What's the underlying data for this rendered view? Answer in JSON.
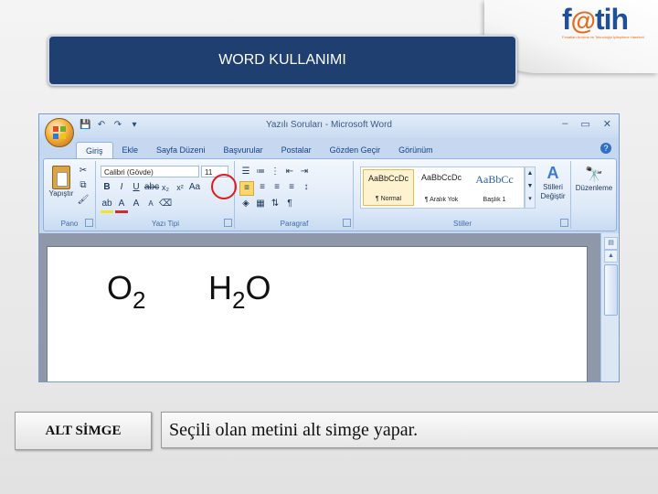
{
  "slide": {
    "title": "WORD KULLANIMI",
    "logo": {
      "name": "fatih-logo",
      "text_f": "f",
      "text_at": "@",
      "text_rest": "tih",
      "subtitle": "Fırsatları Artırma ve Teknolojiyi İyileştirme Hareketi"
    },
    "term": "ALT SİMGE",
    "definition": "Seçili olan metini alt simge yapar."
  },
  "word": {
    "window_title": "Yazılı Soruları - Microsoft Word",
    "quick_access": [
      "save-icon",
      "undo-icon",
      "redo-icon",
      "customize-icon"
    ],
    "window_controls": [
      "–",
      "▭",
      "✕"
    ],
    "tabs": [
      "Giriş",
      "Ekle",
      "Sayfa Düzeni",
      "Başvurular",
      "Postalar",
      "Gözden Geçir",
      "Görünüm"
    ],
    "active_tab": "Giriş",
    "groups": {
      "clipboard": {
        "label": "Pano",
        "paste_label": "Yapıştır"
      },
      "font": {
        "label": "Yazı Tipi",
        "font_name": "Calibri (Gövde)",
        "font_size": "11"
      },
      "paragraph": {
        "label": "Paragraf"
      },
      "styles": {
        "label": "Stiller",
        "items": [
          {
            "sample": "AaBbCcDc",
            "name": "¶ Normal"
          },
          {
            "sample": "AaBbCcDc",
            "name": "¶ Aralık Yok"
          },
          {
            "sample": "AaBbCc",
            "name": "Başlık 1"
          }
        ],
        "change_styles": "Stilleri Değiştir"
      },
      "editing": {
        "label": "Düzenleme"
      }
    },
    "highlighted_button": "subscript-button",
    "document": {
      "formula1": {
        "base": "O",
        "sub": "2"
      },
      "formula2": {
        "base1": "H",
        "sub": "2",
        "base2": "O"
      }
    },
    "accent_color": "#1e3f70",
    "highlight_color": "#e01b1b"
  }
}
